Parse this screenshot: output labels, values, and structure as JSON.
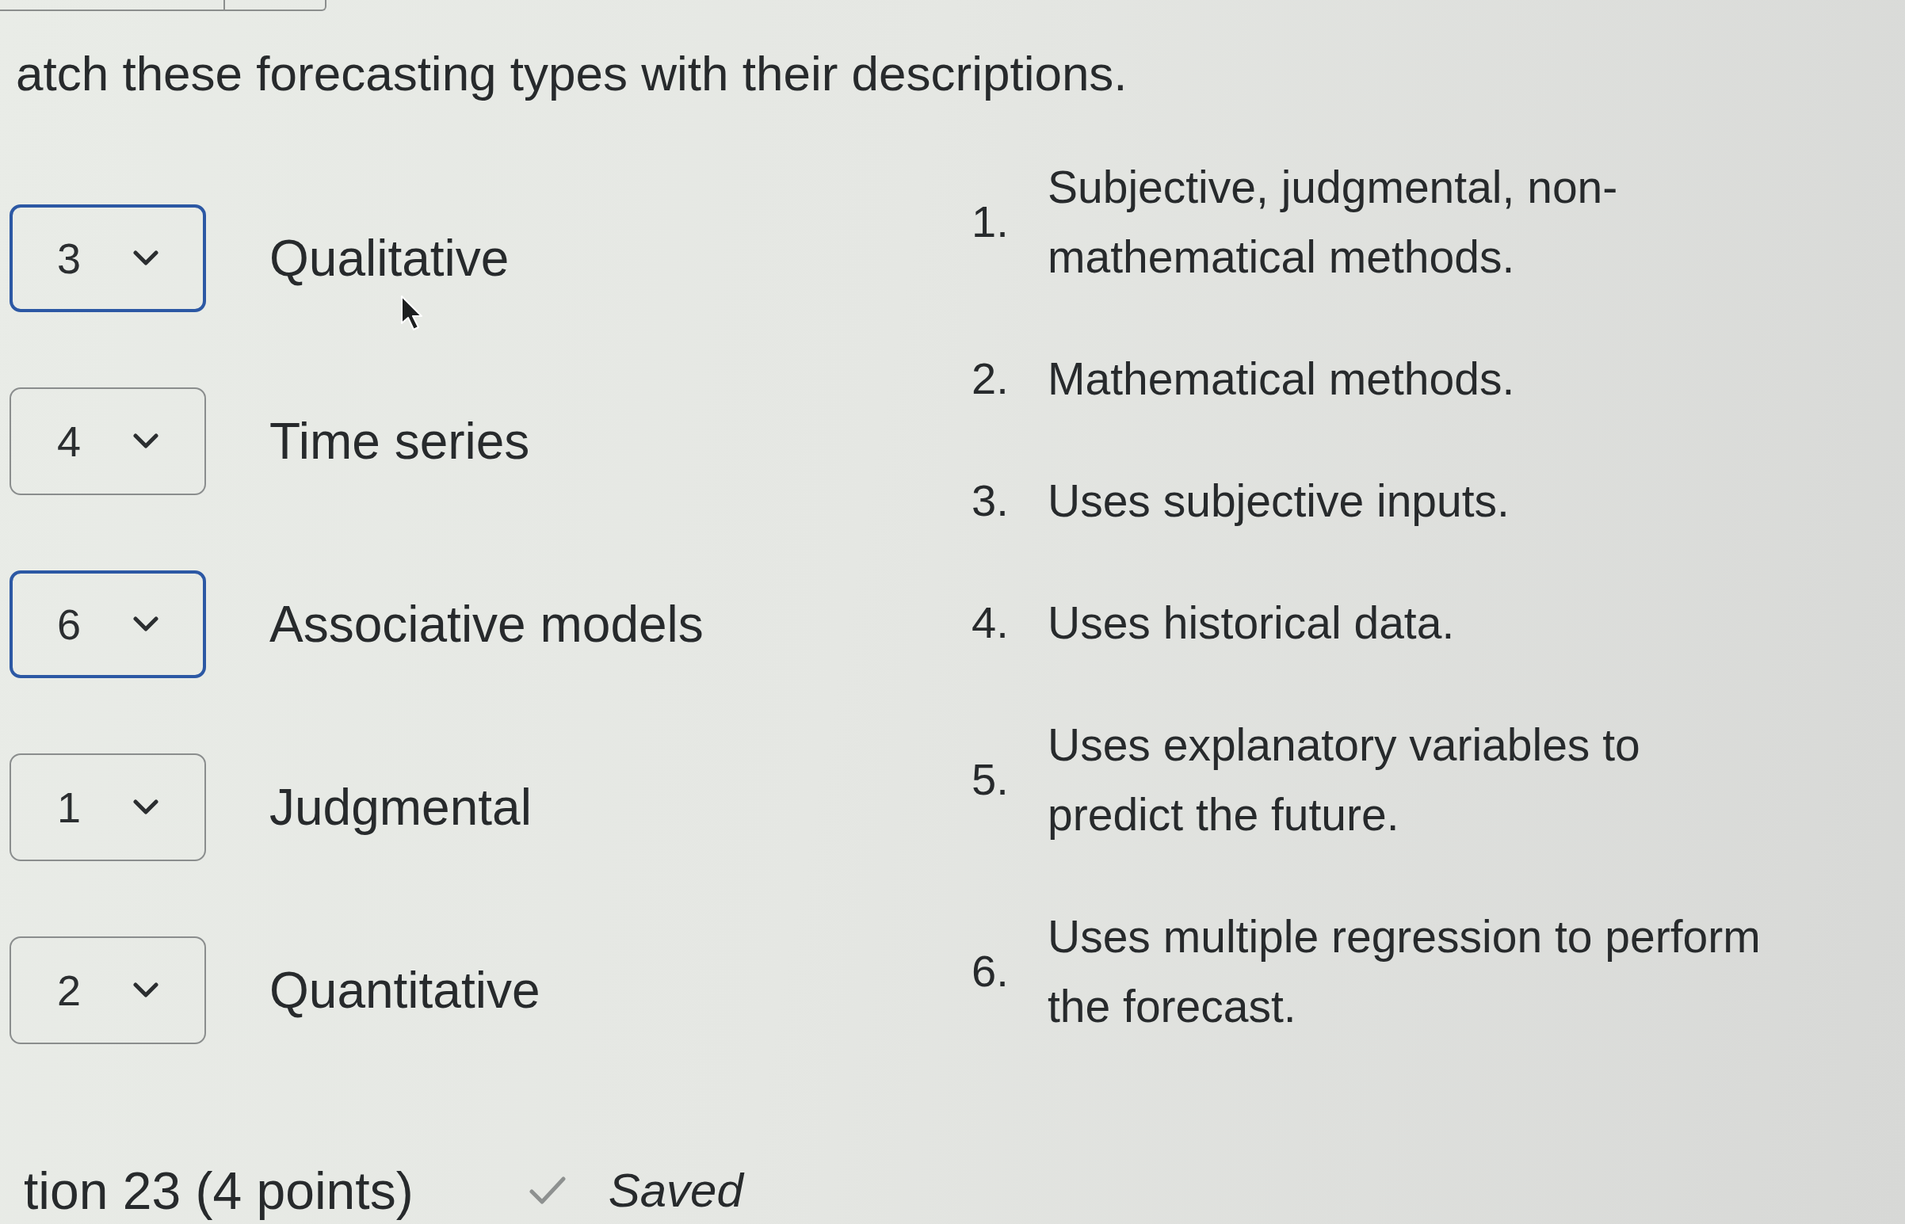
{
  "question": {
    "prompt": "atch these forecasting types with their descriptions.",
    "matches": [
      {
        "answer": "3",
        "highlighted": true,
        "term": "Qualitative"
      },
      {
        "answer": "4",
        "highlighted": false,
        "term": "Time series"
      },
      {
        "answer": "6",
        "highlighted": true,
        "term": "Associative models"
      },
      {
        "answer": "1",
        "highlighted": false,
        "term": "Judgmental"
      },
      {
        "answer": "2",
        "highlighted": false,
        "term": "Quantitative"
      }
    ],
    "descriptions": [
      {
        "number": "1.",
        "text": "Subjective, judgmental, non-mathematical methods."
      },
      {
        "number": "2.",
        "text": "Mathematical methods."
      },
      {
        "number": "3.",
        "text": "Uses subjective inputs."
      },
      {
        "number": "4.",
        "text": "Uses historical data."
      },
      {
        "number": "5.",
        "text": "Uses explanatory variables to predict the future."
      },
      {
        "number": "6.",
        "text": "Uses multiple regression to perform the forecast."
      }
    ]
  },
  "footer": {
    "question_label": "tion 23 (4 points)",
    "status": "Saved"
  }
}
